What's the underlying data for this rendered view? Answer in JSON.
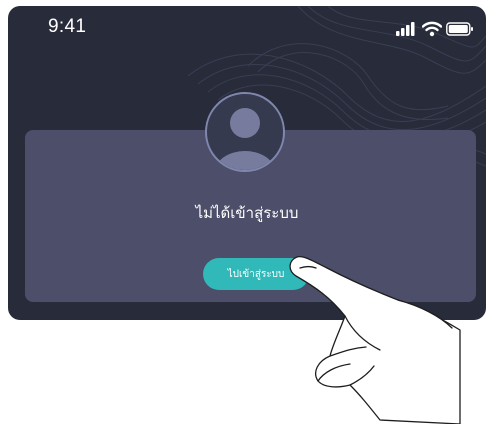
{
  "status_bar": {
    "time": "9:41",
    "icons": [
      "cellular-signal-icon",
      "wifi-icon",
      "battery-icon"
    ]
  },
  "card": {
    "avatar_icon": "user-avatar-icon",
    "message": "ไม่ได้เข้าสู่ระบบ",
    "login_button_label": "ไปเข้าสู่ระบบ"
  },
  "gesture": {
    "hand_icon": "pointing-hand-icon"
  },
  "colors": {
    "screen_background": "#282b3a",
    "card_background": "#4d4e6a",
    "button": "#31b8b8",
    "text": "#ffffff"
  }
}
